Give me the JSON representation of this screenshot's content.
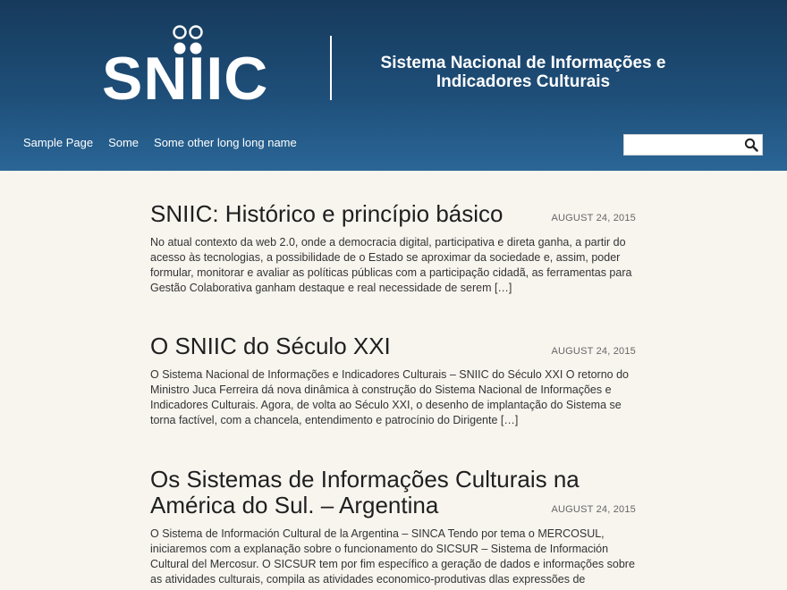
{
  "header": {
    "logo_text": "SNIIC",
    "site_title_line1": "Sistema Nacional de Informações e",
    "site_title_line2": "Indicadores Culturais",
    "colors": {
      "header_top": "#163a5c",
      "header_bottom": "#2a6697",
      "page_bg": "#f8f5ef"
    }
  },
  "nav": {
    "items": [
      {
        "label": "Sample Page"
      },
      {
        "label": "Some"
      },
      {
        "label": "Some other long long name"
      }
    ]
  },
  "search": {
    "value": "",
    "placeholder": "",
    "icon": "search-icon"
  },
  "posts": [
    {
      "title": "SNIIC: Histórico e princípio básico",
      "date": "AUGUST 24, 2015",
      "excerpt": "No atual contexto da web 2.0, onde a democracia digital, participativa e direta ganha, a partir do acesso às tecnologias, a possibilidade de o Estado se aproximar da sociedade e, assim, poder formular, monitorar e avaliar as políticas públicas com a participação cidadã, as ferramentas para Gestão Colaborativa ganham destaque e real necessidade de serem […]"
    },
    {
      "title": "O SNIIC do Século XXI",
      "date": "AUGUST 24, 2015",
      "excerpt": "O Sistema Nacional de Informações e Indicadores Culturais – SNIIC do Século XXI O retorno do Ministro Juca Ferreira dá nova dinâmica à construção do Sistema Nacional de Informações e Indicadores Culturais. Agora, de volta ao Século XXI, o desenho de implantação do Sistema se torna factível, com a chancela, entendimento e patrocínio do Dirigente […]"
    },
    {
      "title": "Os Sistemas de Informações Culturais na América do Sul. – Argentina",
      "date": "AUGUST 24, 2015",
      "excerpt": "O Sistema de Información Cultural de la Argentina – SINCA Tendo por tema o MERCOSUL, iniciaremos com a explanação sobre o funcionamento do SICSUR – Sistema de Información Cultural del Mercosur. O SICSUR tem por fim específico a geração de dados e informações sobre as atividades culturais, compila as atividades economico-produtivas dlas expressões de"
    }
  ]
}
